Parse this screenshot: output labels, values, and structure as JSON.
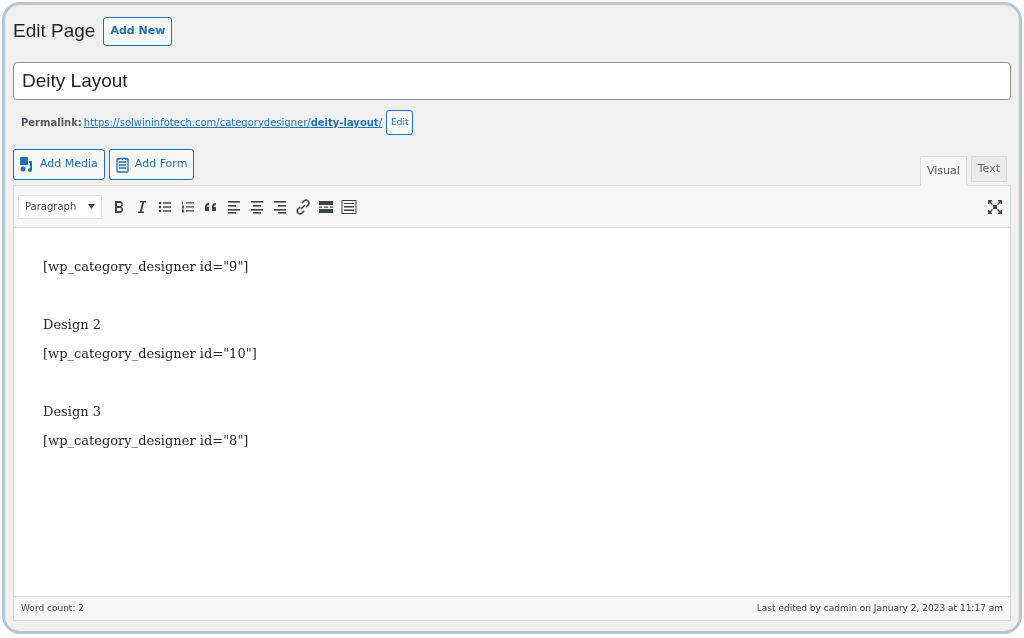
{
  "heading": "Edit Page",
  "add_new": "Add New",
  "title_field": {
    "value": "Deity Layout"
  },
  "permalink": {
    "label": "Permalink:",
    "url": "https://solwininfotech.com/categorydesigner/**deity-layout**/",
    "edit": "Edit"
  },
  "media_buttons": [
    {
      "kind": "media",
      "label": "Add Media"
    },
    {
      "kind": "form",
      "label": "Add Form"
    }
  ],
  "tabs": [
    {
      "label": "Visual",
      "selected": true
    },
    {
      "label": "Text",
      "selected": false
    }
  ],
  "format_select": {
    "value": "Paragraph"
  },
  "content": [
    {
      "lines": [
        "[wp_category_designer id=\"9\"]"
      ]
    },
    {
      "lines": [
        "Design 2",
        "[wp_category_designer id=\"10\"]"
      ]
    },
    {
      "lines": [
        "Design 3",
        "[wp_category_designer id=\"8\"]"
      ]
    }
  ],
  "status_bar": {
    "word_count": "Word count: 2",
    "last_edited": "Last edited by cadmin on January 2, 2023 at 11:17 am"
  }
}
